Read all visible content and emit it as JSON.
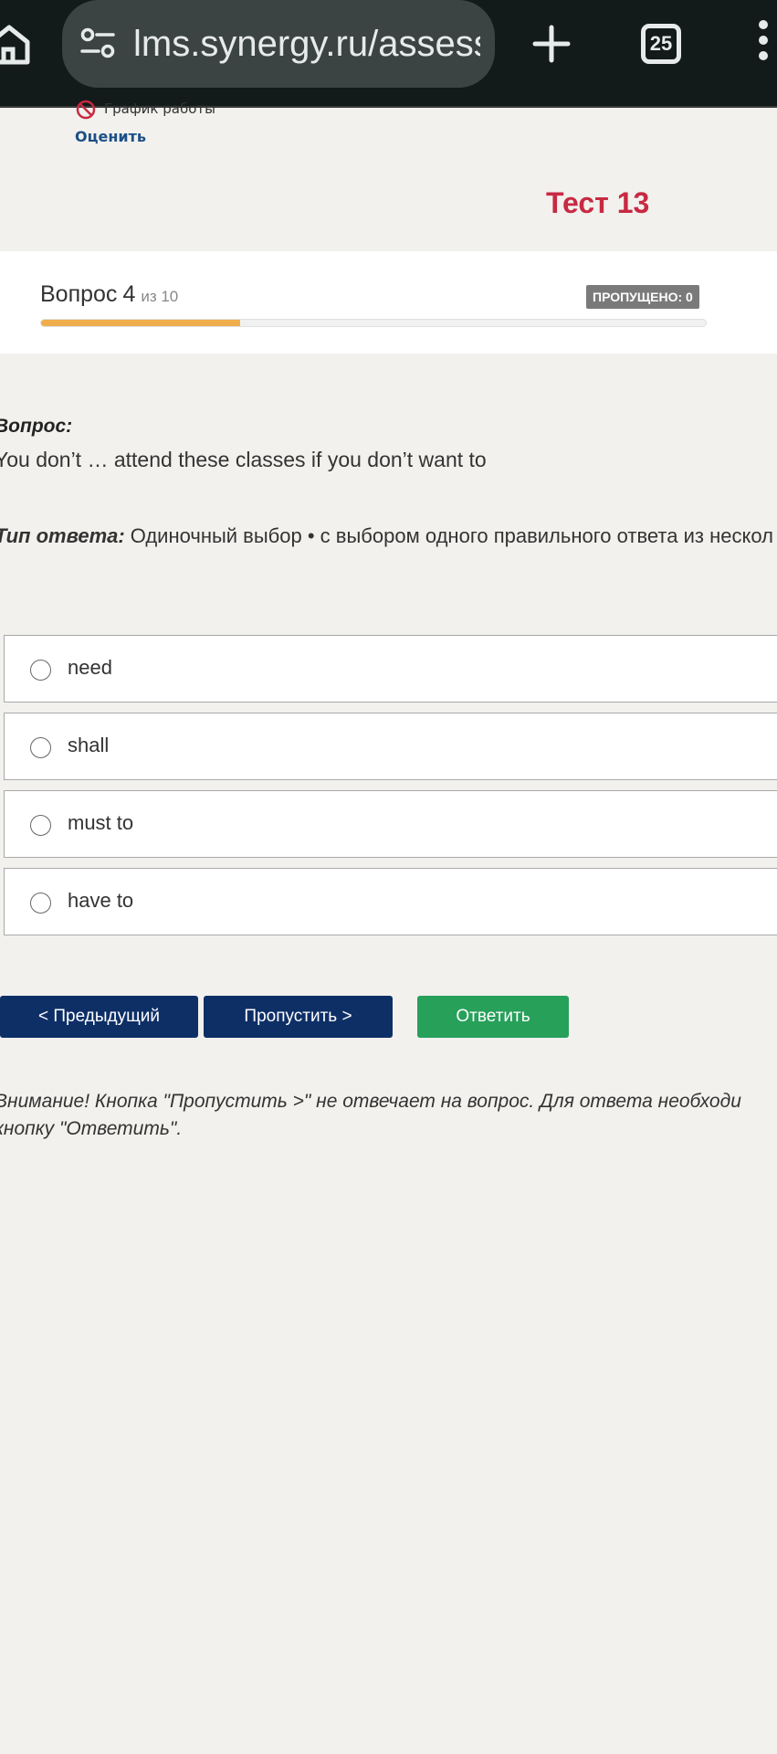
{
  "browser": {
    "url": "lms.synergy.ru/assess",
    "tab_count": "25",
    "colors": {
      "bar": "#121a1a",
      "url_pill": "#3c4443",
      "icon": "#e6ebea"
    }
  },
  "header": {
    "schedule_label": "График работы",
    "rate_link": "Оценить",
    "test_title": "Тест 13"
  },
  "progress": {
    "question_word": "Вопрос",
    "current": "4",
    "of_total": "из 10",
    "skipped_badge": "ПРОПУЩЕНО: 0",
    "fill_fraction": 0.3,
    "fill_color": "#efae4b"
  },
  "question": {
    "heading": "Вопрос:",
    "text": "You don’t … attend these classes if you don’t want to",
    "answer_type_label": "Тип ответа:",
    "answer_type_value": "Одиночный выбор • с выбором одного правильного ответа из нескол"
  },
  "options": [
    {
      "label": "need"
    },
    {
      "label": "shall"
    },
    {
      "label": "must to"
    },
    {
      "label": "have to"
    }
  ],
  "buttons": {
    "prev": "< Предыдущий",
    "skip": "Пропустить >",
    "answer": "Ответить"
  },
  "note": {
    "line1": "Внимание! Кнопка \"Пропустить >\" не отвечает на вопрос. Для ответа необходи",
    "line2": "кнопку \"Ответить\"."
  }
}
